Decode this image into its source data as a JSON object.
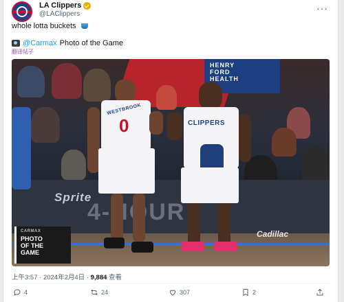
{
  "account": {
    "name": "LA Clippers",
    "handle": "@LAClippers",
    "brand_colors": {
      "blue": "#1d428a",
      "red": "#c8102e"
    },
    "verified_badge": "gold-check-icon"
  },
  "tweet": {
    "text": "whole lotta buckets",
    "text_emoji": "bucket-icon",
    "sponsor_prefix_icon": "camera-icon",
    "sponsor_mention": "@Carmax",
    "sponsor_text": "Photo of the Game",
    "translate_label": "翻译帖子"
  },
  "image": {
    "sign_text": "HENRY\nFORD\nHEALTH",
    "ad_text": "Sprite",
    "ad_big": "4-HOUR",
    "player1_name": "WESTBROOK",
    "player1_number": "0",
    "player2_name": "CLIPPERS",
    "overlay_brand": "CARMAX",
    "overlay_title": "PHOTO\nOF THE\nGAME",
    "floor_text": "Cadillac"
  },
  "meta": {
    "time": "上午3:57",
    "date": "2024年2月4日",
    "views": "9,884",
    "views_label": "查看"
  },
  "actions": {
    "reply_count": "4",
    "retweet_count": "24",
    "like_count": "307",
    "bookmark_count": "2"
  }
}
